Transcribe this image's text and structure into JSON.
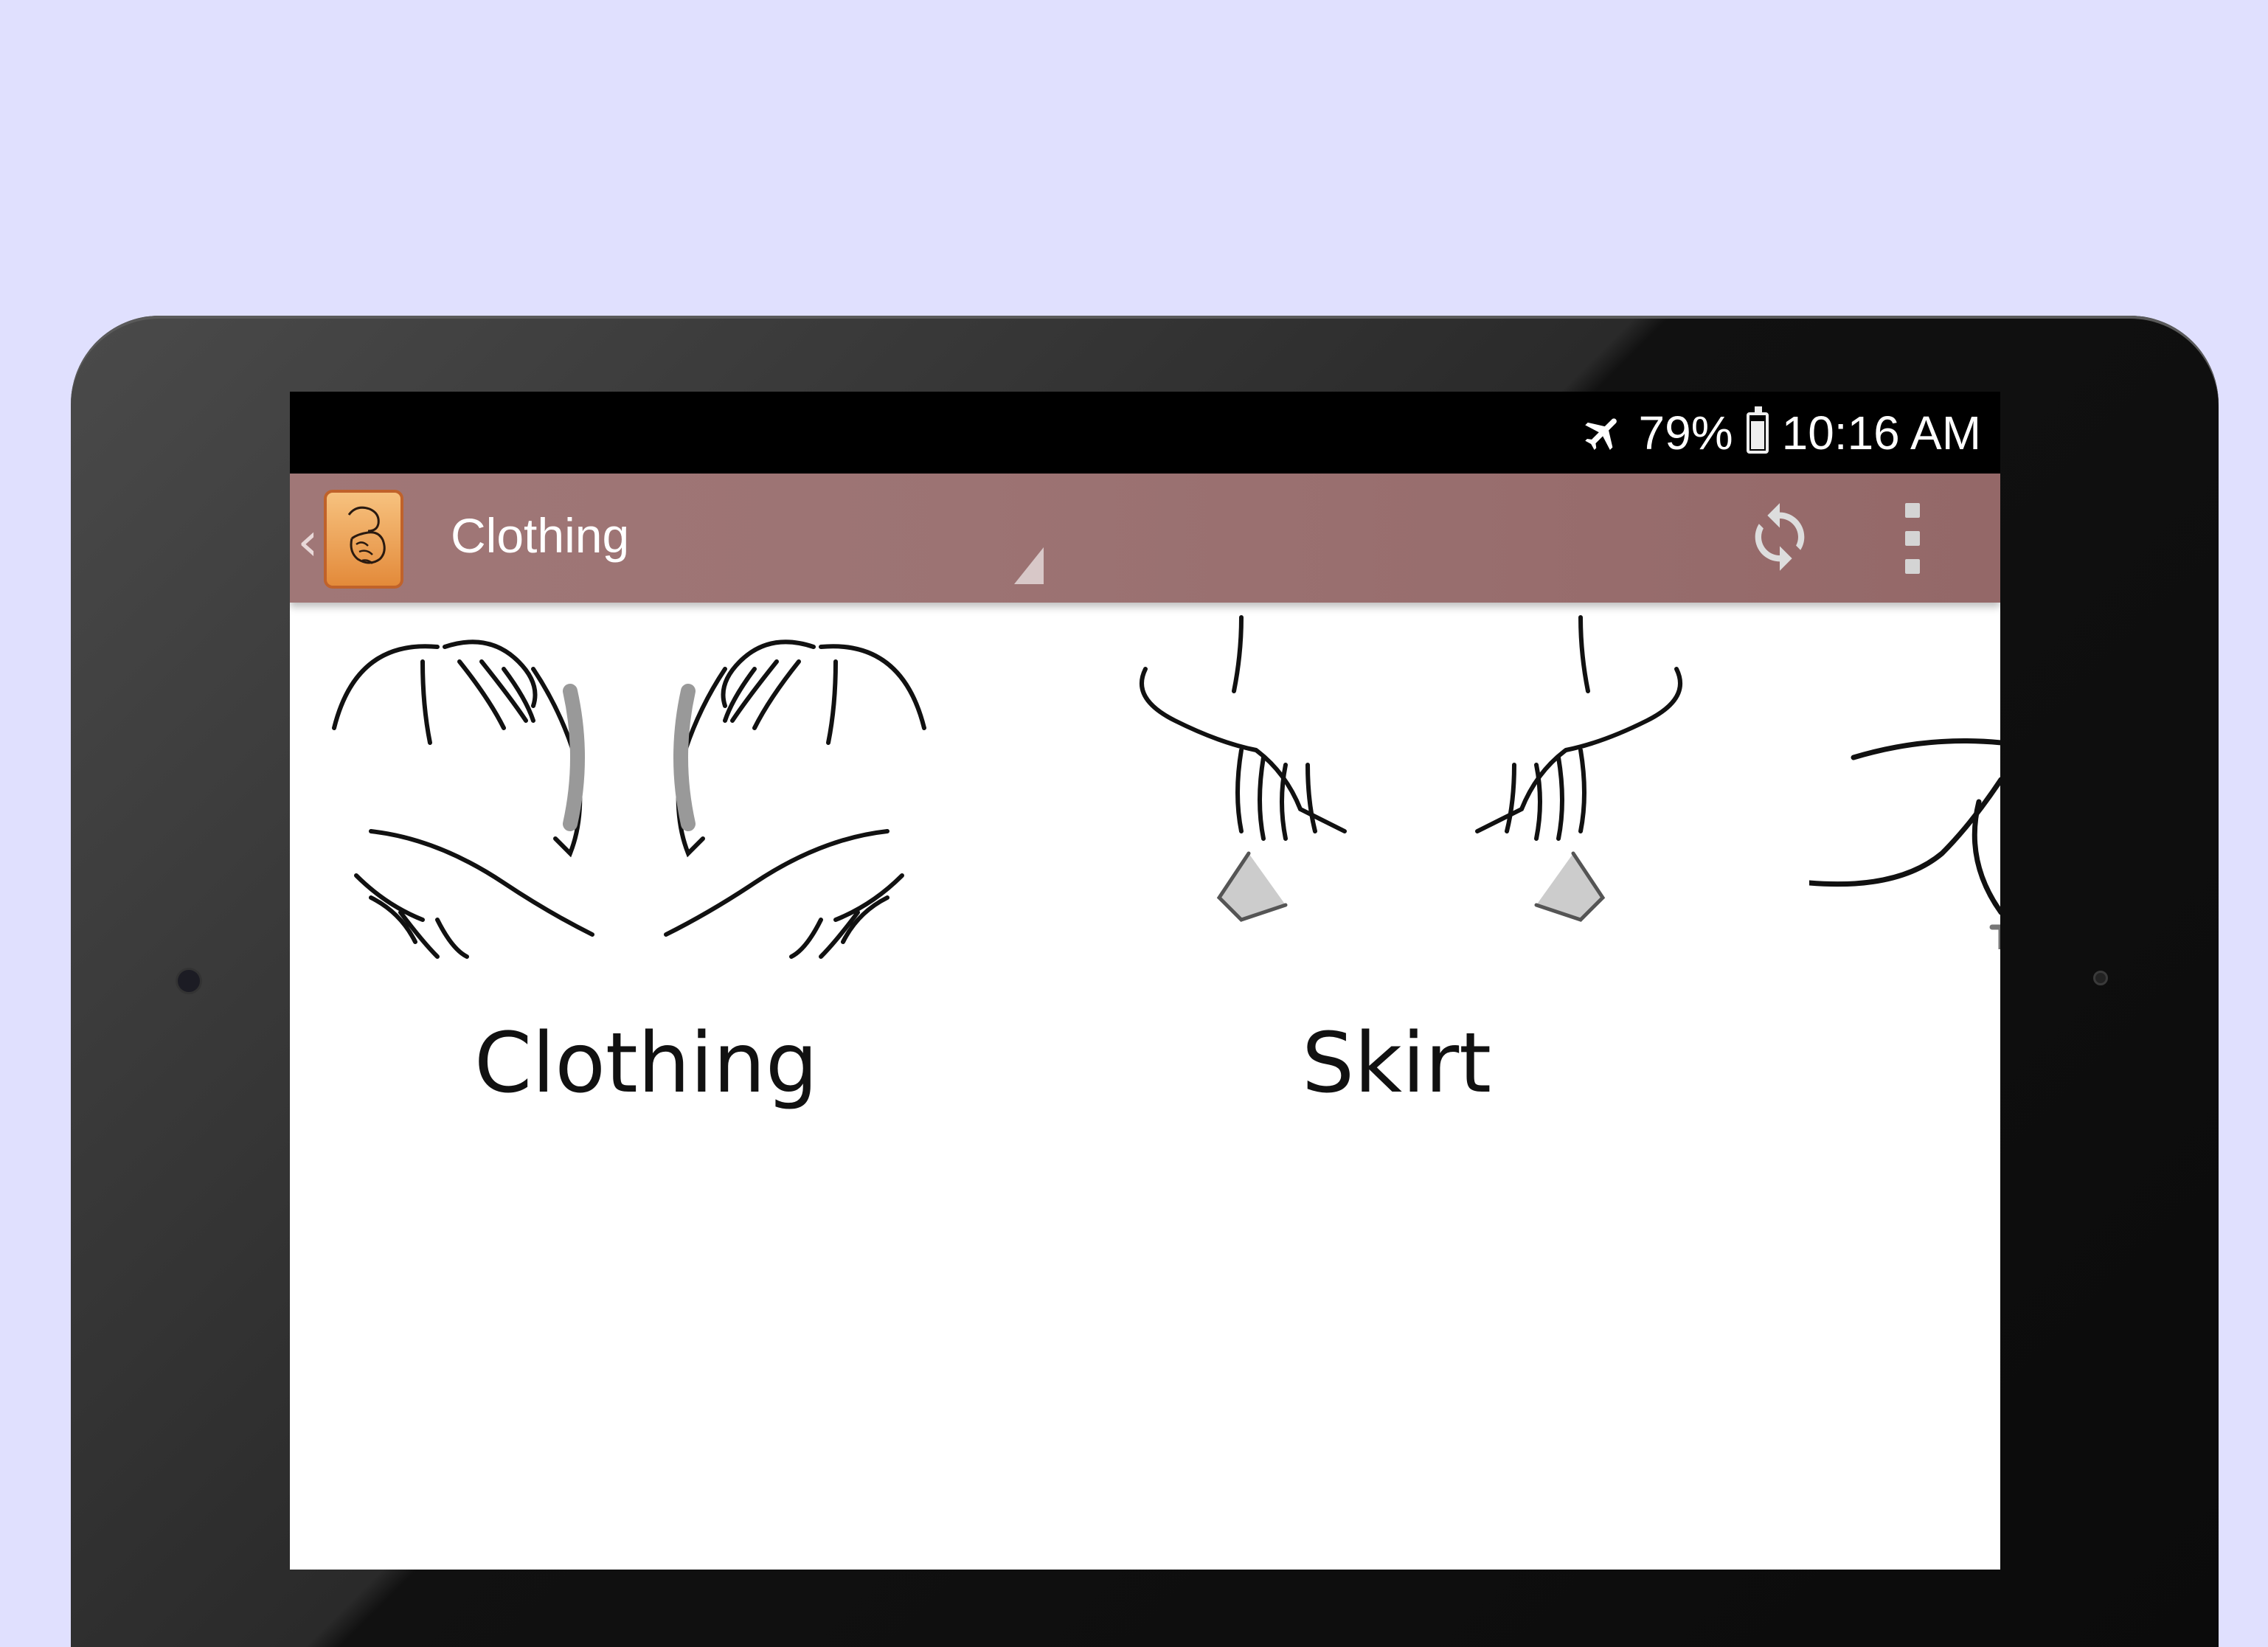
{
  "status_bar": {
    "battery": "79%",
    "time": "10:16 AM",
    "icons": [
      "airplane-mode-icon",
      "battery-icon"
    ]
  },
  "action_bar": {
    "title": "Clothing",
    "back_icon": "chevron-left-icon",
    "actions": [
      "refresh-icon",
      "overflow-menu-icon"
    ]
  },
  "signs": [
    {
      "label": "Clothing"
    },
    {
      "label": "Skirt"
    }
  ],
  "colors": {
    "background": "#e0e0fe",
    "action_bar": "#9c7373",
    "status_bar": "#000000"
  }
}
